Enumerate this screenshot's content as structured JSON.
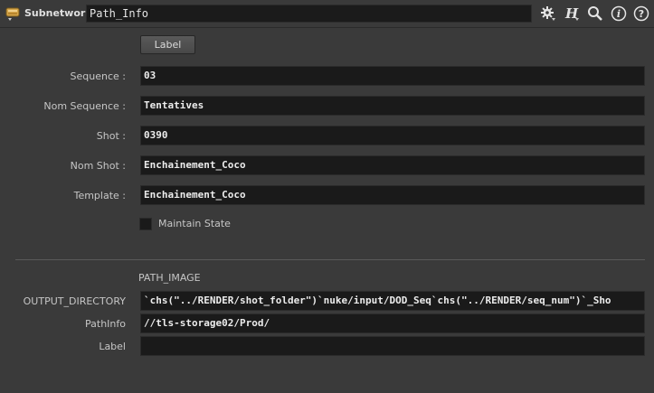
{
  "header": {
    "node_type": "Subnetwork",
    "node_name": "Path_Info",
    "tools": [
      {
        "name": "gear-icon"
      },
      {
        "name": "houdini-h-icon"
      },
      {
        "name": "search-icon"
      },
      {
        "name": "info-icon"
      },
      {
        "name": "help-icon"
      }
    ]
  },
  "parms": {
    "label_button": "Label",
    "sequence": {
      "label": "Sequence :",
      "value": "03"
    },
    "nom_sequence": {
      "label": "Nom Sequence :",
      "value": "Tentatives"
    },
    "shot": {
      "label": "Shot :",
      "value": "0390"
    },
    "nom_shot": {
      "label": "Nom Shot :",
      "value": "Enchainement_Coco"
    },
    "template": {
      "label": "Template :",
      "value": "Enchainement_Coco"
    },
    "maintain_state": {
      "label": "Maintain State",
      "checked": false
    },
    "section_title": "PATH_IMAGE",
    "output_directory": {
      "label": "OUTPUT_DIRECTORY",
      "value": "`chs(\"../RENDER/shot_folder\")`nuke/input/DOD_Seq`chs(\"../RENDER/seq_num\")`_Sho"
    },
    "path_info": {
      "label": "PathInfo",
      "value": "//tls-storage02/Prod/"
    },
    "label_field": {
      "label": "Label",
      "value": ""
    }
  },
  "colors": {
    "background": "#3a3a3a",
    "field_bg": "#1a1a1a",
    "text": "#cfcfcf"
  }
}
